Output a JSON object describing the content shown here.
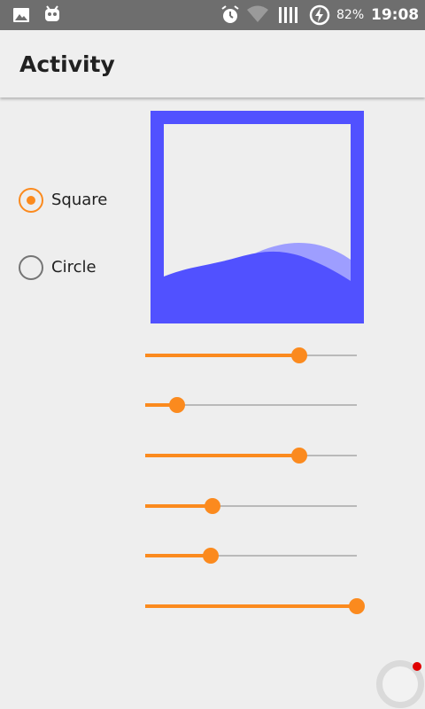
{
  "status_bar": {
    "battery_percent": "82%",
    "time": "19:08",
    "left_icons": [
      "image-icon",
      "android-debug-icon"
    ],
    "right_icons": [
      "alarm-icon",
      "wifi-icon",
      "signal-icon",
      "battery-charging-icon"
    ]
  },
  "app_bar": {
    "title": "Activity"
  },
  "shape_options": [
    {
      "label": "Square",
      "selected": true
    },
    {
      "label": "Circle",
      "selected": false
    }
  ],
  "wave_view": {
    "shape": "Square",
    "border_color": "#5151ff",
    "wave_color": "#5151ff",
    "behind_wave_color": "#9e9eff"
  },
  "sliders": [
    {
      "name": "slider-1",
      "value": 0.73
    },
    {
      "name": "slider-2",
      "value": 0.15
    },
    {
      "name": "slider-3",
      "value": 0.73
    },
    {
      "name": "slider-4",
      "value": 0.32
    },
    {
      "name": "slider-5",
      "value": 0.31
    },
    {
      "name": "slider-6",
      "value": 1.0
    }
  ],
  "colors": {
    "accent": "#fb8a1e",
    "track": "#b9b9b9",
    "background": "#eeeeee",
    "status_bar": "#6e6e6e",
    "notification_dot": "#e00000"
  }
}
